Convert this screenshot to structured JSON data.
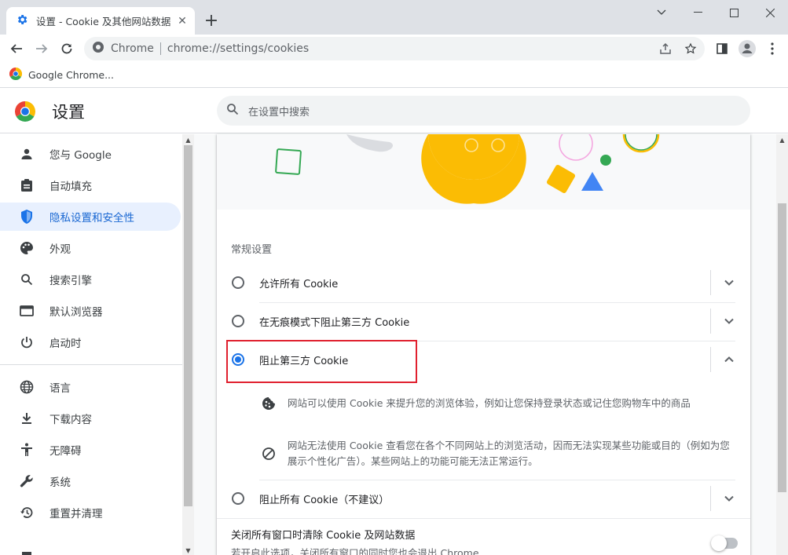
{
  "window": {
    "tab_title": "设置 - Cookie 及其他网站数据",
    "new_tab_label": "+"
  },
  "toolbar": {
    "site_label": "Chrome",
    "url": "chrome://settings/cookies"
  },
  "bookmarks": [
    {
      "label": "Google Chrome..."
    }
  ],
  "header": {
    "title": "设置",
    "search_placeholder": "在设置中搜索"
  },
  "sidebar": {
    "items": [
      {
        "label": "您与 Google",
        "icon": "person-icon"
      },
      {
        "label": "自动填充",
        "icon": "clipboard-icon"
      },
      {
        "label": "隐私设置和安全性",
        "icon": "shield-icon",
        "active": true
      },
      {
        "label": "外观",
        "icon": "palette-icon"
      },
      {
        "label": "搜索引擎",
        "icon": "search-icon"
      },
      {
        "label": "默认浏览器",
        "icon": "browser-icon"
      },
      {
        "label": "启动时",
        "icon": "power-icon"
      },
      {
        "label": "语言",
        "icon": "globe-icon"
      },
      {
        "label": "下载内容",
        "icon": "download-icon"
      },
      {
        "label": "无障碍",
        "icon": "accessibility-icon"
      },
      {
        "label": "系统",
        "icon": "wrench-icon"
      },
      {
        "label": "重置并清理",
        "icon": "restore-icon"
      }
    ]
  },
  "main": {
    "section_title": "常规设置",
    "options": [
      {
        "label": "允许所有 Cookie",
        "checked": false
      },
      {
        "label": "在无痕模式下阻止第三方 Cookie",
        "checked": false
      },
      {
        "label": "阻止第三方 Cookie",
        "checked": true
      },
      {
        "label": "阻止所有 Cookie（不建议）",
        "checked": false
      }
    ],
    "details": [
      "网站可以使用 Cookie 来提升您的浏览体验，例如让您保持登录状态或记住您购物车中的商品",
      "网站无法使用 Cookie 查看您在各个不同网站上的浏览活动，因而无法实现某些功能或目的（例如为您展示个性化广告）。某些网站上的功能可能无法正常运行。"
    ],
    "clear_on_exit": {
      "title": "关闭所有窗口时清除 Cookie 及网站数据",
      "subtitle": "若开启此选项，关闭所有窗口的同时您也会退出 Chrome",
      "enabled": false
    }
  },
  "colors": {
    "accent": "#1a73e8",
    "highlight_box": "#e0202e",
    "active_nav_bg": "#e8f0fe"
  }
}
